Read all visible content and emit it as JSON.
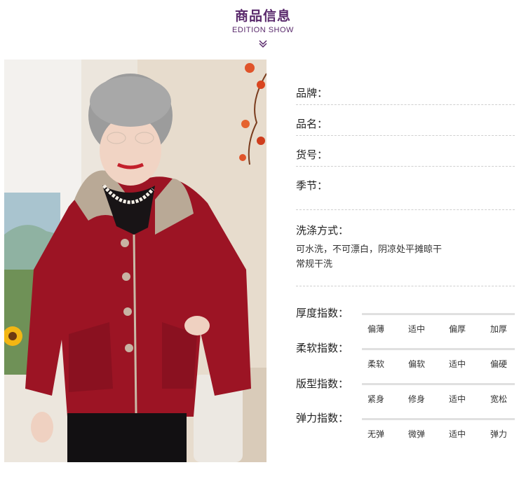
{
  "header": {
    "title": "商品信息",
    "subtitle": "EDITION SHOW"
  },
  "product_photo": {
    "icon": "model-wearing-red-hooded-jacket-photo",
    "colors": {
      "jacket": "#9c1424",
      "lining": "#b9a996",
      "background": "#e9e3da"
    }
  },
  "specs": [
    {
      "label": "品牌："
    },
    {
      "label": "品名："
    },
    {
      "label": "货号："
    },
    {
      "label": "季节："
    }
  ],
  "wash": {
    "label": "洗涤方式：",
    "line1": "可水洗，不可漂白，阴凉处平摊晾干",
    "line2": "常规干洗"
  },
  "indices": [
    {
      "label": "厚度指数：",
      "options": [
        "偏薄",
        "适中",
        "偏厚",
        "加厚"
      ]
    },
    {
      "label": "柔软指数：",
      "options": [
        "柔软",
        "偏软",
        "适中",
        "偏硬"
      ]
    },
    {
      "label": "版型指数：",
      "options": [
        "紧身",
        "修身",
        "适中",
        "宽松"
      ]
    },
    {
      "label": "弹力指数：",
      "options": [
        "无弹",
        "微弹",
        "适中",
        "弹力"
      ]
    }
  ],
  "colors": {
    "accent": "#5a2a6c"
  }
}
